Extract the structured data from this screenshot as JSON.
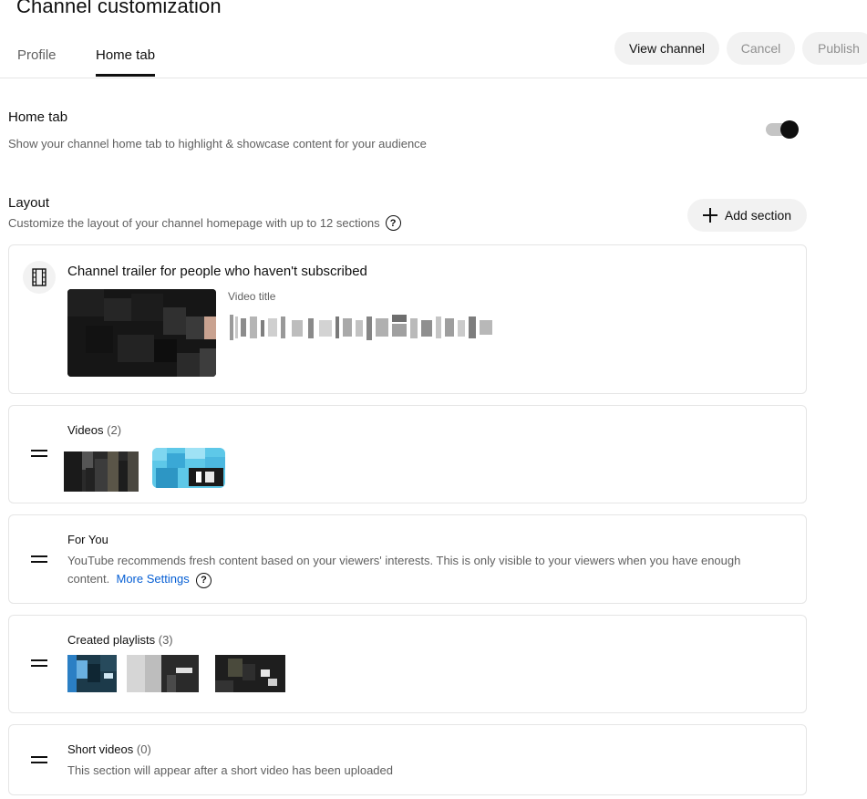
{
  "header": {
    "title": "Channel customization",
    "tabs": [
      {
        "label": "Profile"
      },
      {
        "label": "Home tab"
      }
    ],
    "buttons": {
      "view_channel": "View channel",
      "cancel": "Cancel",
      "publish": "Publish"
    }
  },
  "home_tab": {
    "heading": "Home tab",
    "description": "Show your channel home tab to highlight & showcase content for your audience",
    "toggle_on": true
  },
  "layout": {
    "heading": "Layout",
    "description": "Customize the layout of your channel homepage with up to 12 sections",
    "add_section_label": "Add section",
    "help_icon": "?"
  },
  "sections": {
    "trailer": {
      "title": "Channel trailer for people who haven't subscribed",
      "video_title_label": "Video title"
    },
    "videos": {
      "title": "Videos",
      "count": "(2)"
    },
    "for_you": {
      "title": "For You",
      "description": "YouTube recommends fresh content based on your viewers' interests. This is only visible to your viewers when you have enough content.",
      "more_settings": "More Settings",
      "help_icon": "?"
    },
    "playlists": {
      "title": "Created playlists",
      "count": "(3)"
    },
    "shorts": {
      "title": "Short videos",
      "count": "(0)",
      "description": "This section will appear after a short video has been uploaded"
    }
  },
  "colors": {
    "link": "#065fd4",
    "text_primary": "#0f0f0f",
    "text_secondary": "#606060",
    "button_bg": "#f2f2f2"
  }
}
